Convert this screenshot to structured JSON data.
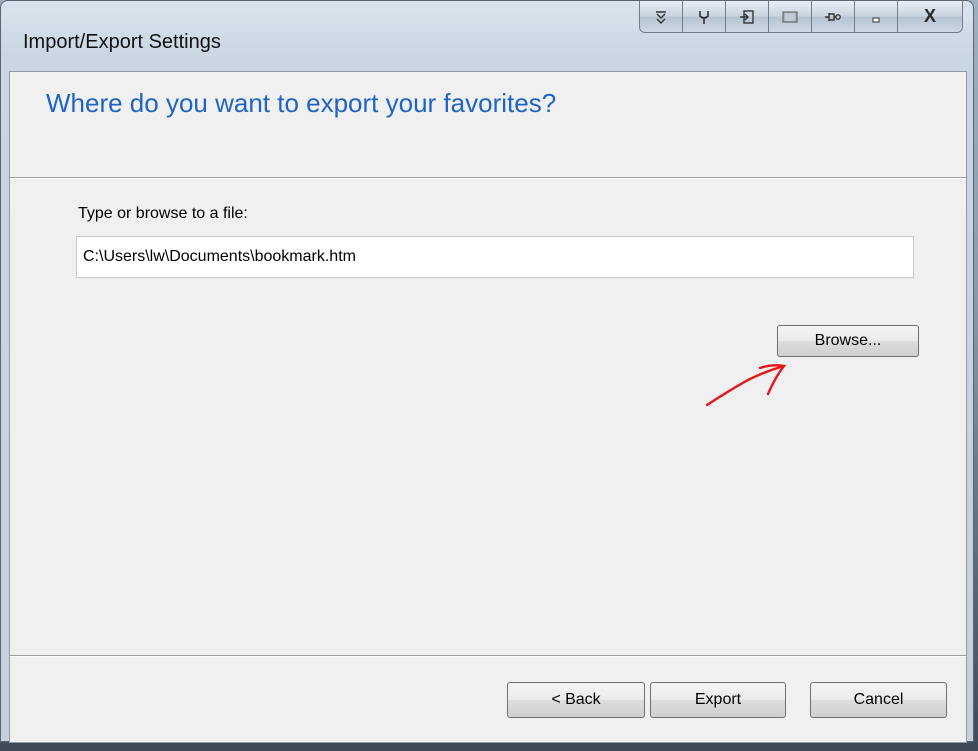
{
  "window": {
    "title": "Import/Export Settings"
  },
  "caption_buttons": [
    {
      "name": "dropdown-icon"
    },
    {
      "name": "tool-icon"
    },
    {
      "name": "login-icon"
    },
    {
      "name": "screen-icon"
    },
    {
      "name": "pin-icon"
    },
    {
      "name": "minimize-icon"
    },
    {
      "name": "close-icon",
      "label": "X"
    }
  ],
  "dialog": {
    "heading": "Where do you want to export your favorites?",
    "field_label": "Type or browse to a file:",
    "path_value": "C:\\Users\\lw\\Documents\\bookmark.htm",
    "browse_label": "Browse...",
    "back_label": "< Back",
    "export_label": "Export",
    "cancel_label": "Cancel"
  },
  "colors": {
    "heading": "#1e64c8",
    "annotation": "#e8141a"
  }
}
